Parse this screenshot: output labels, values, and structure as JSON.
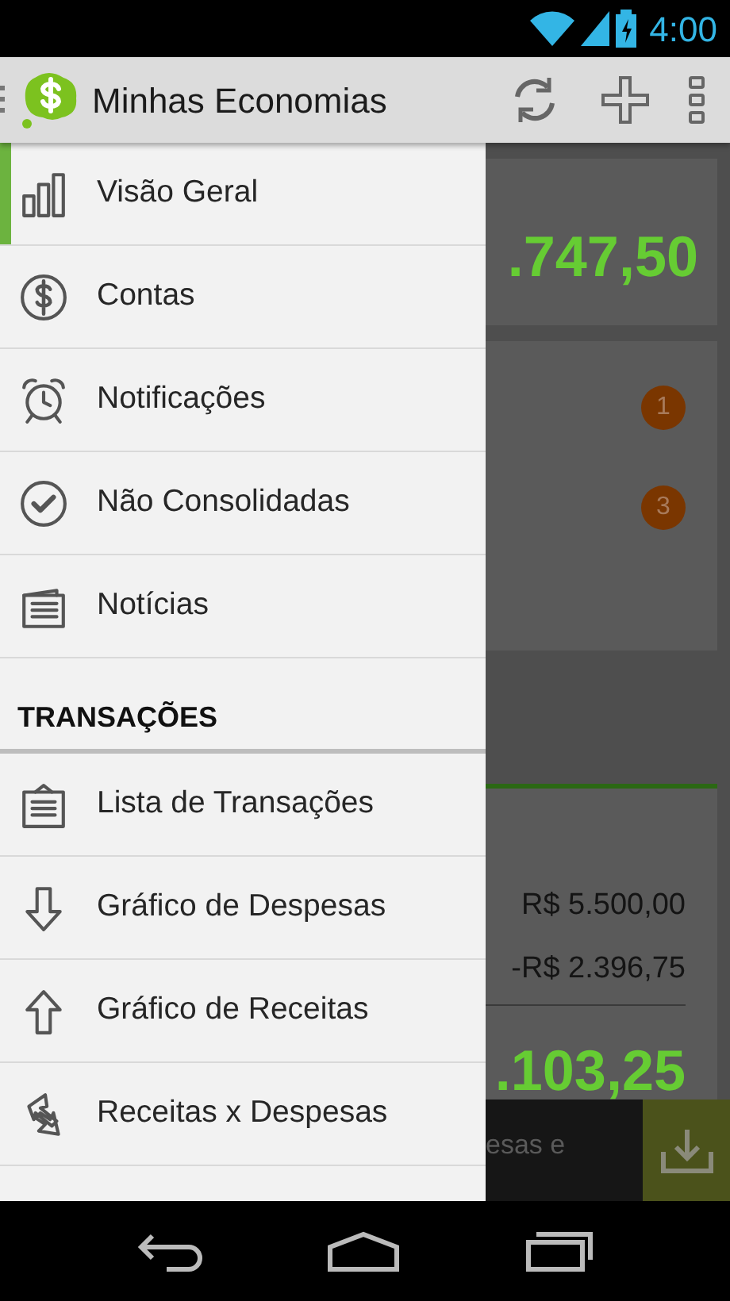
{
  "status_bar": {
    "time": "4:00"
  },
  "action_bar": {
    "title": "Minhas Economias"
  },
  "drawer": {
    "items": [
      {
        "label": "Visão Geral",
        "selected": true
      },
      {
        "label": "Contas",
        "selected": false
      },
      {
        "label": "Notificações",
        "selected": false
      },
      {
        "label": "Não Consolidadas",
        "selected": false
      },
      {
        "label": "Notícias",
        "selected": false
      }
    ],
    "section": {
      "title": "TRANSAÇÕES",
      "items": [
        {
          "label": "Lista de Transações",
          "selected": false
        },
        {
          "label": "Gráfico de Despesas",
          "selected": false
        },
        {
          "label": "Gráfico de Receitas",
          "selected": false
        },
        {
          "label": "Receitas x Despesas",
          "selected": false
        }
      ]
    }
  },
  "background": {
    "balance": ".747,50",
    "badges": [
      "1",
      "3"
    ],
    "summary": {
      "rows": [
        "R$ 5.500,00",
        "-R$ 2.396,75"
      ],
      "total": ".103,25"
    },
    "banner": {
      "text": "esas e"
    }
  }
}
